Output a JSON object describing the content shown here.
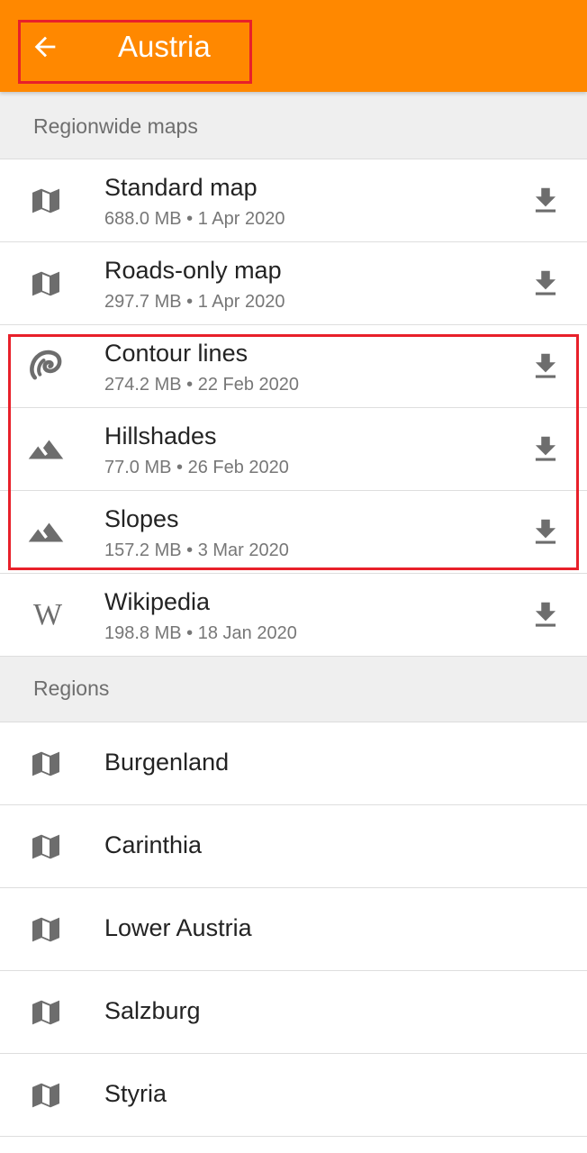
{
  "header": {
    "title": "Austria",
    "back_icon": "arrow-left-icon",
    "background_color": "#ff8800"
  },
  "sections": {
    "regionwide": {
      "label": "Regionwide maps",
      "items": [
        {
          "name": "Standard map",
          "size": "688.0 MB",
          "date": "1 Apr 2020",
          "meta": "688.0 MB • 1 Apr 2020",
          "icon": "map-icon"
        },
        {
          "name": "Roads-only map",
          "size": "297.7 MB",
          "date": "1 Apr 2020",
          "meta": "297.7 MB • 1 Apr 2020",
          "icon": "map-icon"
        },
        {
          "name": "Contour lines",
          "size": "274.2 MB",
          "date": "22 Feb 2020",
          "meta": "274.2 MB • 22 Feb 2020",
          "icon": "contour-icon"
        },
        {
          "name": "Hillshades",
          "size": "77.0 MB",
          "date": "26 Feb 2020",
          "meta": "77.0 MB • 26 Feb 2020",
          "icon": "mountains-icon"
        },
        {
          "name": "Slopes",
          "size": "157.2 MB",
          "date": "3 Mar 2020",
          "meta": "157.2 MB • 3 Mar 2020",
          "icon": "mountains-icon"
        },
        {
          "name": "Wikipedia",
          "size": "198.8 MB",
          "date": "18 Jan 2020",
          "meta": "198.8 MB • 18 Jan 2020",
          "icon": "wikipedia-icon",
          "glyph": "W"
        }
      ]
    },
    "regions": {
      "label": "Regions",
      "items": [
        {
          "name": "Burgenland",
          "icon": "map-icon"
        },
        {
          "name": "Carinthia",
          "icon": "map-icon"
        },
        {
          "name": "Lower Austria",
          "icon": "map-icon"
        },
        {
          "name": "Salzburg",
          "icon": "map-icon"
        },
        {
          "name": "Styria",
          "icon": "map-icon"
        }
      ]
    }
  },
  "colors": {
    "accent": "#ff8800",
    "highlight": "#e8202a",
    "icon": "#6d6d6d"
  }
}
